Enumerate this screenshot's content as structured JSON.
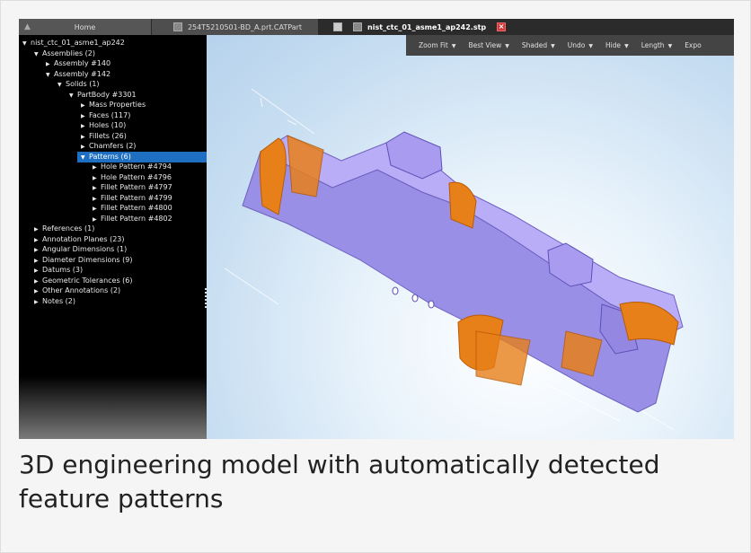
{
  "tabs": {
    "home": "Home",
    "part": "254T5210501-BD_A.prt.CATPart",
    "stp": "nist_ctc_01_asme1_ap242.stp"
  },
  "toolbar": [
    {
      "label": "Zoom Fit"
    },
    {
      "label": "Best View"
    },
    {
      "label": "Shaded"
    },
    {
      "label": "Undo"
    },
    {
      "label": "Hide"
    },
    {
      "label": "Length"
    },
    {
      "label": "Expo"
    }
  ],
  "tree": [
    {
      "label": "nist_ctc_01_asme1_ap242",
      "level": 0,
      "state": "open"
    },
    {
      "label": "Assemblies (2)",
      "level": 1,
      "state": "open"
    },
    {
      "label": "Assembly #140",
      "level": 2,
      "state": "closed"
    },
    {
      "label": "Assembly #142",
      "level": 2,
      "state": "open"
    },
    {
      "label": "Solids (1)",
      "level": 3,
      "state": "open"
    },
    {
      "label": "PartBody #3301",
      "level": 4,
      "state": "open"
    },
    {
      "label": "Mass Properties",
      "level": 5,
      "state": "closed"
    },
    {
      "label": "Faces (117)",
      "level": 5,
      "state": "closed"
    },
    {
      "label": "Holes (10)",
      "level": 5,
      "state": "closed"
    },
    {
      "label": "Fillets (26)",
      "level": 5,
      "state": "closed"
    },
    {
      "label": "Chamfers (2)",
      "level": 5,
      "state": "closed"
    },
    {
      "label": "Patterns (6)",
      "level": 5,
      "state": "open",
      "selected": true
    },
    {
      "label": "Hole Pattern #4794",
      "level": 6,
      "state": "closed"
    },
    {
      "label": "Hole Pattern #4796",
      "level": 6,
      "state": "closed"
    },
    {
      "label": "Fillet Pattern #4797",
      "level": 6,
      "state": "closed"
    },
    {
      "label": "Fillet Pattern #4799",
      "level": 6,
      "state": "closed"
    },
    {
      "label": "Fillet Pattern #4800",
      "level": 6,
      "state": "closed"
    },
    {
      "label": "Fillet Pattern #4802",
      "level": 6,
      "state": "closed"
    },
    {
      "label": "References (1)",
      "level": 1,
      "state": "closed"
    },
    {
      "label": "Annotation Planes (23)",
      "level": 1,
      "state": "closed"
    },
    {
      "label": "Angular Dimensions (1)",
      "level": 1,
      "state": "closed"
    },
    {
      "label": "Diameter Dimensions (9)",
      "level": 1,
      "state": "closed"
    },
    {
      "label": "Datums (3)",
      "level": 1,
      "state": "closed"
    },
    {
      "label": "Geometric Tolerances (6)",
      "level": 1,
      "state": "closed"
    },
    {
      "label": "Other Annotations (2)",
      "level": 1,
      "state": "closed"
    },
    {
      "label": "Notes (2)",
      "level": 1,
      "state": "closed"
    }
  ],
  "caption": "3D engineering model with automatically detected feature patterns",
  "colors": {
    "selection": "#1e6fc2",
    "model_face": "#a99cf0",
    "model_pattern": "#e8801a"
  }
}
